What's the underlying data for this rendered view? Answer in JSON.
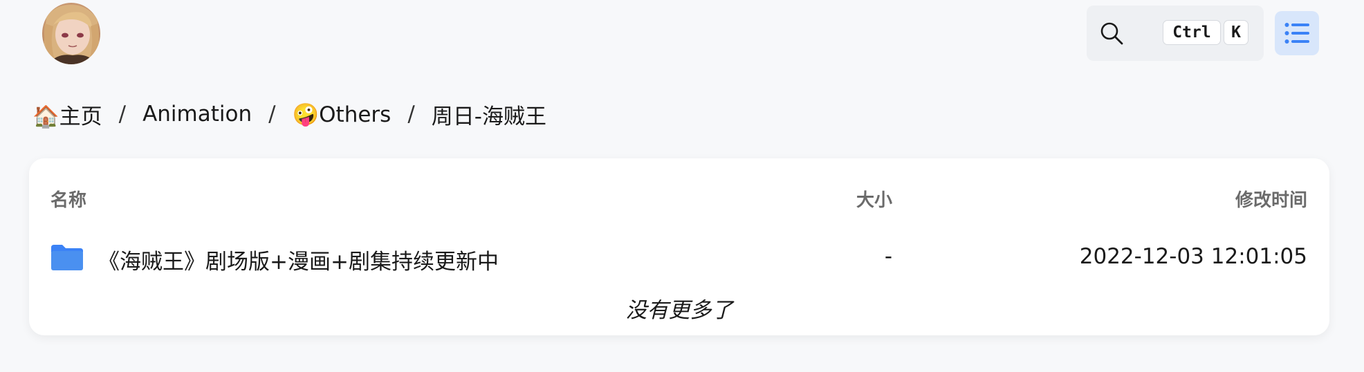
{
  "header": {
    "search": {
      "shortcut_ctrl": "Ctrl",
      "shortcut_key": "K"
    }
  },
  "breadcrumb": [
    {
      "label": "🏠主页"
    },
    {
      "label": "Animation"
    },
    {
      "label": "🤪Others"
    },
    {
      "label": "周日-海贼王"
    }
  ],
  "breadcrumb_separator": "/",
  "table": {
    "columns": {
      "name": "名称",
      "size": "大小",
      "modified": "修改时间"
    },
    "rows": [
      {
        "icon": "folder-icon",
        "name": "《海贼王》剧场版+漫画+剧集持续更新中",
        "size": "-",
        "modified": "2022-12-03 12:01:05"
      }
    ],
    "footer_text": "没有更多了"
  },
  "colors": {
    "accent": "#3b82f6",
    "menu_button_bg": "#d8e6fb",
    "page_bg": "#f7f8fa"
  }
}
